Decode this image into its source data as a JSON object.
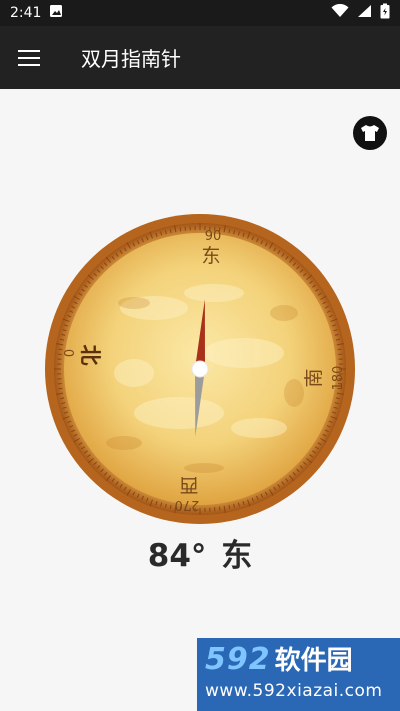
{
  "status_bar": {
    "time": "2:41",
    "icons": [
      "image-icon",
      "wifi-icon",
      "signal-icon",
      "battery-icon"
    ]
  },
  "app_bar": {
    "title": "双月指南针",
    "menu_icon": "hamburger-icon"
  },
  "skin_button": {
    "icon": "shirt-icon"
  },
  "compass": {
    "heading_degrees": 84,
    "dial_labels": {
      "north_deg": "0",
      "east_deg": "90",
      "south_deg": "180",
      "west_deg": "270",
      "north": "北",
      "east": "东",
      "south": "南",
      "west": "西"
    }
  },
  "reading": {
    "degrees": "84°",
    "direction": "东"
  },
  "watermark": {
    "digits": "592",
    "text": "软件园",
    "url": "www.592xiazai.com"
  },
  "colors": {
    "status_bar": "#1a1a1a",
    "app_bar": "#222222",
    "dial_fill": "#f3d27a",
    "dial_rim": "#b5651d",
    "needle_north": "#a8311a",
    "needle_south": "#9c9c9c",
    "watermark_bg": "#2a67b5"
  }
}
